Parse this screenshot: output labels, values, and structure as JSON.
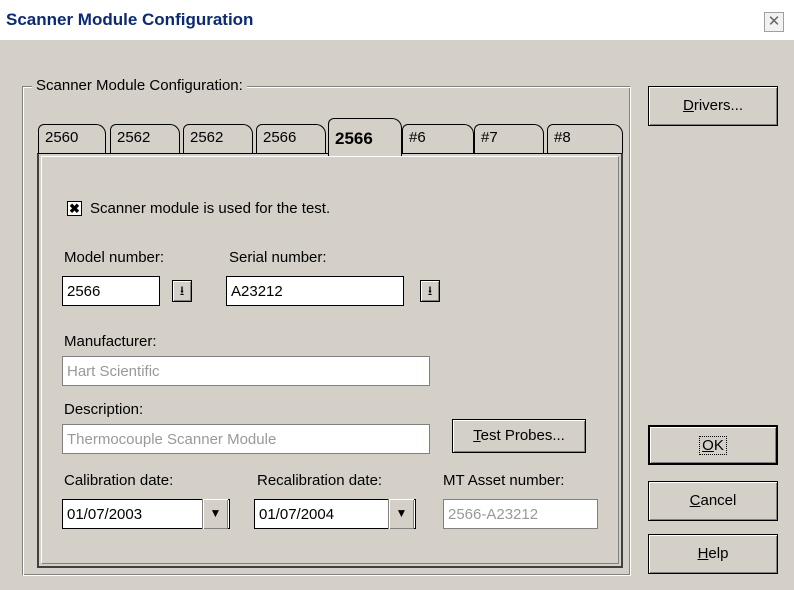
{
  "window": {
    "title": "Scanner Module Configuration",
    "close_glyph": "✕"
  },
  "group": {
    "label": "Scanner Module Configuration:"
  },
  "tabs": [
    {
      "label": "2560"
    },
    {
      "label": "2562"
    },
    {
      "label": "2562"
    },
    {
      "label": "2566"
    },
    {
      "label": "2566",
      "active": true
    },
    {
      "label": "#6"
    },
    {
      "label": "#7"
    },
    {
      "label": "#8"
    }
  ],
  "form": {
    "used_checkbox": {
      "checked": true,
      "mark": "✖",
      "label": "Scanner module is used for the test."
    },
    "model": {
      "label": "Model number:",
      "value": "2566"
    },
    "serial": {
      "label": "Serial number:",
      "value": "A23212"
    },
    "manufacturer": {
      "label": "Manufacturer:",
      "value": "Hart Scientific"
    },
    "description": {
      "label": "Description:",
      "value": "Thermocouple Scanner Module"
    },
    "calibration": {
      "label": "Calibration date:",
      "value": "01/07/2003"
    },
    "recalibration": {
      "label": "Recalibration date:",
      "value": "01/07/2004"
    },
    "asset": {
      "label": "MT Asset number:",
      "value": "2566-A23212"
    },
    "test_probes_button": {
      "first": "T",
      "rest": "est Probes..."
    }
  },
  "buttons": {
    "drivers": {
      "first": "D",
      "rest": "rivers..."
    },
    "ok": {
      "first": "O",
      "rest": "K"
    },
    "cancel": {
      "first": "C",
      "rest": "ancel"
    },
    "help": {
      "first": "H",
      "rest": "elp"
    }
  },
  "icons": {
    "dropdown_small": "⭳",
    "combo_arrow": "▼"
  }
}
